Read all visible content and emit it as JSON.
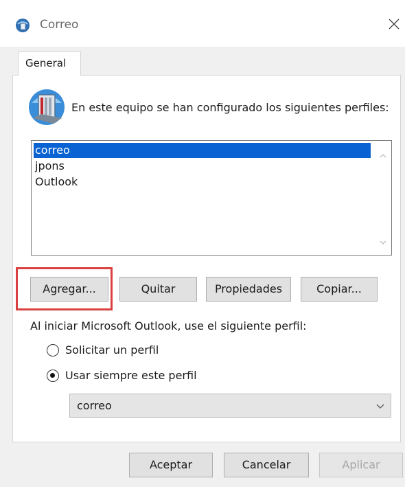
{
  "window": {
    "title": "Correo",
    "icon": "mail-profile-icon",
    "close_icon": "close-icon"
  },
  "tabs": [
    {
      "label": "General",
      "selected": true
    }
  ],
  "description": "En este equipo se han configurado los siguientes perfiles:",
  "profiles": {
    "items": [
      "correo",
      "jpons",
      "Outlook"
    ],
    "selected": "correo"
  },
  "profile_buttons": {
    "add": "Agregar...",
    "remove": "Quitar",
    "properties": "Propiedades",
    "copy": "Copiar..."
  },
  "startup": {
    "label": "Al iniciar Microsoft Outlook, use el siguiente perfil:",
    "options": [
      {
        "label": "Solicitar un perfil",
        "checked": false
      },
      {
        "label": "Usar siempre este perfil",
        "checked": true
      }
    ],
    "always_use_profile": "correo"
  },
  "footer_buttons": {
    "ok": "Aceptar",
    "cancel": "Cancelar",
    "apply": "Aplicar",
    "apply_enabled": false
  },
  "colors": {
    "selection": "#0a63d2",
    "highlight_box": "#d9403f"
  }
}
